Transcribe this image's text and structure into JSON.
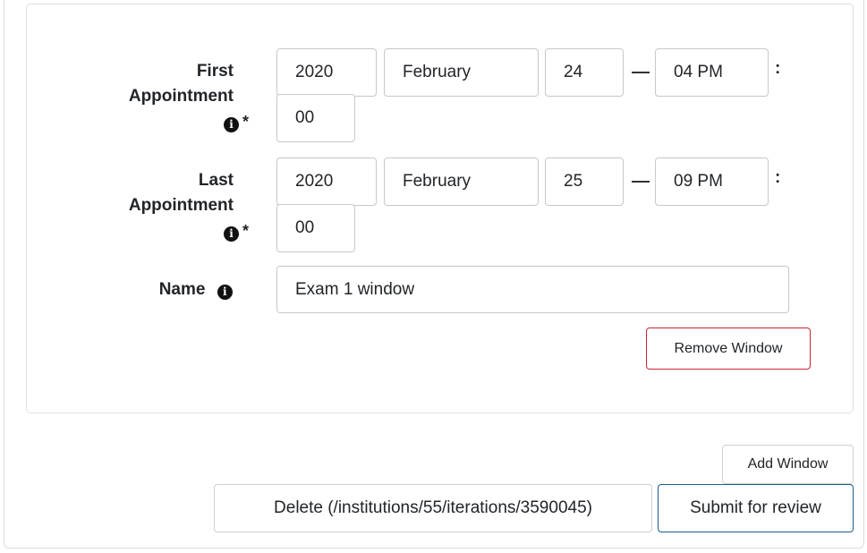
{
  "first_appointment": {
    "label_line1": "First",
    "label_line2": "Appointment",
    "required_mark": "*",
    "year": "2020",
    "month": "February",
    "day": "24",
    "hour": "04 PM",
    "minute": "00",
    "separator": ":"
  },
  "last_appointment": {
    "label_line1": "Last",
    "label_line2": "Appointment",
    "required_mark": "*",
    "year": "2020",
    "month": "February",
    "day": "25",
    "hour": "09 PM",
    "minute": "00",
    "separator": ":"
  },
  "name_field": {
    "label": "Name",
    "value": "Exam 1 window"
  },
  "icons": {
    "info": "info-circle-icon",
    "info_glyph": "i"
  },
  "buttons": {
    "remove_window": "Remove Window",
    "add_window": "Add Window",
    "delete": "Delete (/institutions/55/iterations/3590045)",
    "submit": "Submit for review"
  },
  "colors": {
    "danger": "#c82333",
    "primary": "#1a5f8a",
    "border": "#c8c8c8"
  }
}
